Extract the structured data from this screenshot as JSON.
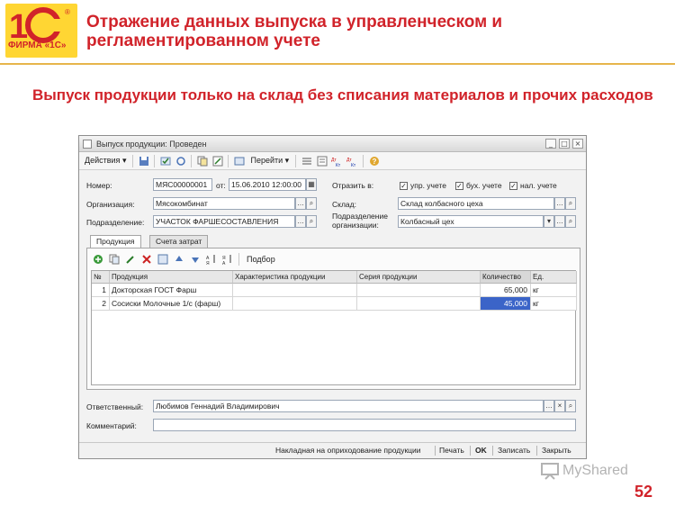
{
  "slide": {
    "logo_sub": "ФИРМА «1С»",
    "title": "Отражение данных выпуска в управленческом и регламентированном учете",
    "subtitle": "Выпуск продукции только на склад без списания материалов и прочих расходов",
    "page_number": "52",
    "watermark": "MyShared",
    "accent_color": "#d1232a"
  },
  "window": {
    "title": "Выпуск продукции: Проведен",
    "toolbar": {
      "actions_label": "Действия",
      "goto_label": "Перейти"
    },
    "form": {
      "number_label": "Номер:",
      "number_value": "МЯС00000001",
      "from_label": "от:",
      "date_value": "15.06.2010 12:00:00",
      "reflect_label": "Отразить в:",
      "check_mgmt_label": "упр. учете",
      "check_acc_label": "бух. учете",
      "check_tax_label": "нал. учете",
      "org_label": "Организация:",
      "org_value": "Мясокомбинат",
      "warehouse_label": "Склад:",
      "warehouse_value": "Склад колбасного цеха",
      "division_label": "Подразделение:",
      "division_value": "УЧАСТОК ФАРШЕСОСТАВЛЕНИЯ",
      "org_division_label_1": "Подразделение",
      "org_division_label_2": "организации:",
      "org_division_value": "Колбасный цех"
    },
    "tabs": [
      {
        "label": "Продукция"
      },
      {
        "label": "Счета затрат"
      }
    ],
    "table_toolbar": {
      "selection_label": "Подбор"
    },
    "table": {
      "headers": [
        "№",
        "Продукция",
        "Характеристика продукции",
        "Серия продукции",
        "Количество",
        "Ед."
      ],
      "rows": [
        [
          "1",
          "Докторская ГОСТ Фарш",
          "",
          "",
          "65,000",
          "кг"
        ],
        [
          "2",
          "Сосиски Молочные 1/с (фарш)",
          "",
          "",
          "45,000",
          "кг"
        ]
      ]
    },
    "responsible_label": "Ответственный:",
    "responsible_value": "Любимов Геннадий Владимирович",
    "comment_label": "Комментарий:",
    "comment_value": "",
    "bottom_buttons": {
      "invoice": "Накладная на оприходование продукции",
      "print": "Печать",
      "ok": "OK",
      "save": "Записать",
      "close": "Закрыть"
    }
  }
}
